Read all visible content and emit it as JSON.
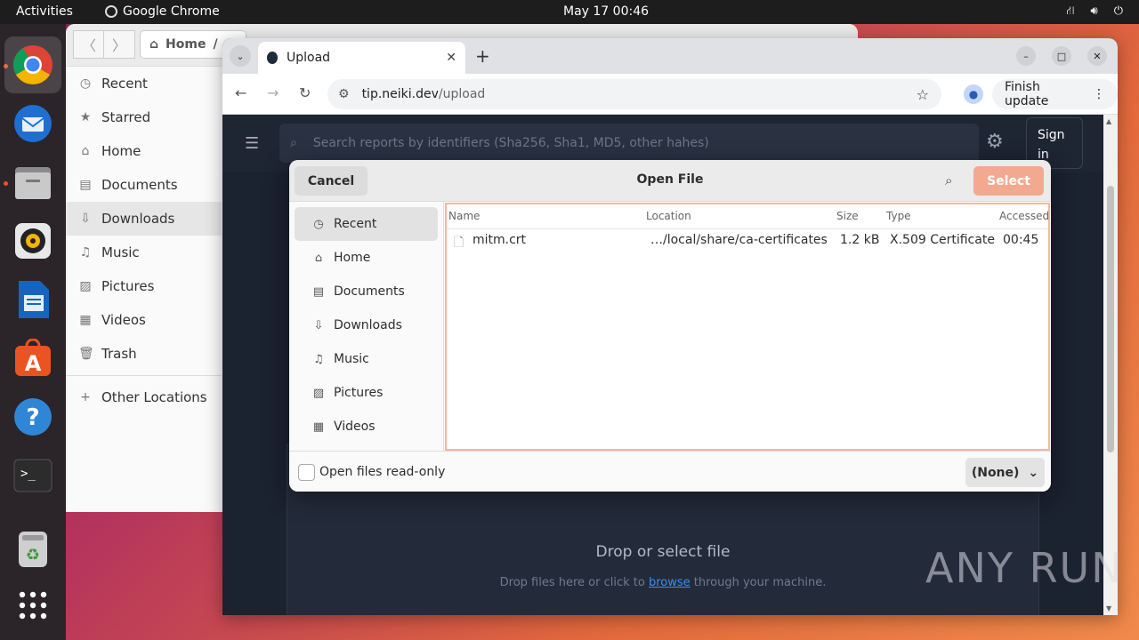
{
  "topbar": {
    "activities": "Activities",
    "app_name": "Google Chrome",
    "clock": "May 17  00:46"
  },
  "dock": {
    "items": [
      "chrome-icon",
      "thunderbird-icon",
      "files-icon",
      "rhythmbox-icon",
      "writer-icon",
      "app-center-icon",
      "help-icon",
      "terminal-icon",
      "trash-icon",
      "app-grid-icon"
    ]
  },
  "files_window": {
    "path": "Home",
    "sidebar": [
      {
        "label": "Recent",
        "icon": "clock-icon"
      },
      {
        "label": "Starred",
        "icon": "star-icon"
      },
      {
        "label": "Home",
        "icon": "home-icon"
      },
      {
        "label": "Documents",
        "icon": "document-icon"
      },
      {
        "label": "Downloads",
        "icon": "download-icon"
      },
      {
        "label": "Music",
        "icon": "music-icon"
      },
      {
        "label": "Pictures",
        "icon": "picture-icon"
      },
      {
        "label": "Videos",
        "icon": "video-icon"
      },
      {
        "label": "Trash",
        "icon": "trash-icon"
      },
      {
        "label": "Other Locations",
        "icon": "plus-icon"
      }
    ]
  },
  "chrome": {
    "tab_title": "Upload",
    "url_host": "tip.neiki.dev",
    "url_path": "/upload",
    "finish_update": "Finish update",
    "page": {
      "search_placeholder": "Search reports by identifiers (Sha256, Sha1, MD5, other hahes)",
      "sign_in_line1": "Sign",
      "sign_in_line2": "in",
      "drop_title": "Drop or select file",
      "drop_sub_before": "Drop files here or click to ",
      "drop_sub_link": "browse",
      "drop_sub_after": " through your machine."
    }
  },
  "dialog": {
    "title": "Open File",
    "cancel": "Cancel",
    "select": "Select",
    "sidebar": [
      {
        "label": "Recent",
        "icon": "clock-icon"
      },
      {
        "label": "Home",
        "icon": "home-icon"
      },
      {
        "label": "Documents",
        "icon": "document-icon"
      },
      {
        "label": "Downloads",
        "icon": "download-icon"
      },
      {
        "label": "Music",
        "icon": "music-icon"
      },
      {
        "label": "Pictures",
        "icon": "picture-icon"
      },
      {
        "label": "Videos",
        "icon": "video-icon"
      }
    ],
    "columns": {
      "name": "Name",
      "location": "Location",
      "size": "Size",
      "type": "Type",
      "accessed": "Accessed"
    },
    "files": [
      {
        "name": "mitm.crt",
        "location": "…/local/share/ca-certificates",
        "size": "1.2 kB",
        "type": "X.509 Certificate",
        "accessed": "00:45"
      }
    ],
    "readonly_label": "Open files read-only",
    "filter": "(None)"
  },
  "watermark": "ANY RUN"
}
